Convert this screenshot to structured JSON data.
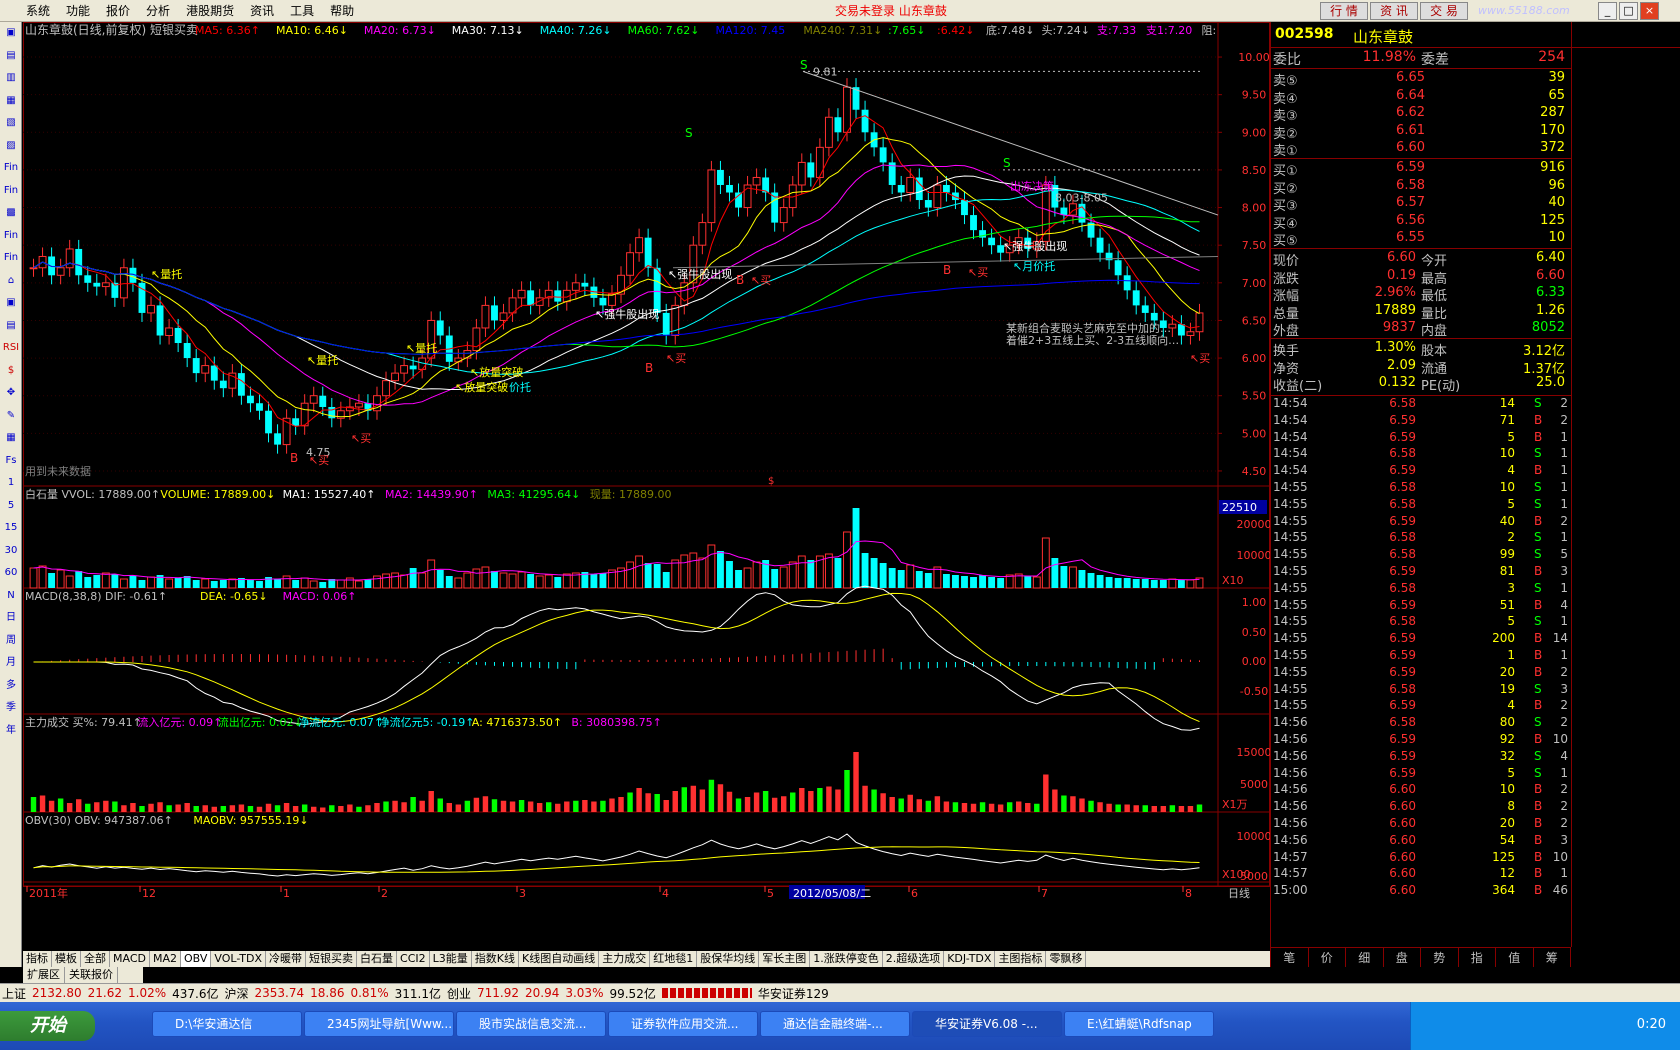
{
  "menu": {
    "items": [
      "系统",
      "功能",
      "报价",
      "分析",
      "港股期货",
      "资讯",
      "工具",
      "帮助"
    ],
    "center": "交易未登录  山东章鼓",
    "buttons": [
      "行 情",
      "资 讯",
      "交 易"
    ],
    "watermark": "www.55188.com"
  },
  "sidebar": {
    "items": [
      "▣",
      "▤",
      "▥",
      "▦",
      "▧",
      "▨",
      "Fin",
      "Fin",
      "▩",
      "Fin",
      "Fin",
      "⌂",
      "▣",
      "▤",
      "RSI",
      "$",
      "✥",
      "✎",
      "▦",
      "Fs",
      "1",
      "5",
      "15",
      "30",
      "60",
      "N",
      "日",
      "周",
      "月",
      "多",
      "季",
      "年"
    ]
  },
  "main": {
    "title": "山东章鼓(日线,前复权) 短银买卖",
    "ma_labels": [
      {
        "t": "MA5: 6.36↑",
        "c": "#ff0000"
      },
      {
        "t": "MA10: 6.46↓",
        "c": "#ffff00"
      },
      {
        "t": "MA20: 6.73↓",
        "c": "#ff00ff"
      },
      {
        "t": "MA30: 7.13↓",
        "c": "#ffffff"
      },
      {
        "t": "MA40: 7.26↓",
        "c": "#00ffff"
      },
      {
        "t": "MA60: 7.62↓",
        "c": "#00ff00"
      },
      {
        "t": "MA120: 7.45",
        "c": "#0000ff"
      },
      {
        "t": "MA240: 7.31↓",
        "c": "#808000"
      }
    ],
    "ind_labels": [
      {
        "t": ":7.65↓",
        "c": "#00ff00"
      },
      {
        "t": ":6.42↓",
        "c": "#ff0000"
      },
      {
        "t": "底:7.48↓",
        "c": "#c0c0c0"
      },
      {
        "t": "头:7.24↓",
        "c": "#c0c0c0"
      },
      {
        "t": "支:7.33",
        "c": "#ff00ff"
      },
      {
        "t": "支1:7.20",
        "c": "#ff00ff"
      },
      {
        "t": "阻:",
        "c": "#c0c0c0"
      }
    ],
    "price_axis": [
      "10.00",
      "9.50",
      "9.00",
      "8.50",
      "8.00",
      "7.50",
      "7.00",
      "6.50",
      "6.00",
      "5.50",
      "5.00",
      "4.50"
    ],
    "annotations": {
      "high": "9.81",
      "low": "4.75",
      "line": "8.03-8.05",
      "note1": "某新组合麦聪头艺麻克至中加的…",
      "note2": "着催2+3五线上买、2-3五线顺向…",
      "usefuture": "用到未来数据",
      "s": "S",
      "b": "B",
      "buy": "买",
      "liangtuo": "量托",
      "qiangniu": "强牛股出现",
      "fangliang": "放量突破",
      "jiatuo": "价托",
      "chudiao": "出冻决策",
      "yuejiatuo": "月价托"
    },
    "vol_labels": [
      {
        "t": "白石量 VVOL: 17889.00↑",
        "c": "#c0c0c0"
      },
      {
        "t": "VOLUME: 17889.00↓",
        "c": "#ffff00"
      },
      {
        "t": "MA1: 15527.40↑",
        "c": "#ffffff"
      },
      {
        "t": "MA2: 14439.90↑",
        "c": "#ff00ff"
      },
      {
        "t": "MA3: 41295.64↓",
        "c": "#00ff00"
      },
      {
        "t": "现量: 17889.00",
        "c": "#808000"
      }
    ],
    "vol_axis": [
      "20000",
      "10000"
    ],
    "vol_badge": "22510",
    "vol_unit": "X10",
    "macd_labels": [
      {
        "t": "MACD(8,38,8)  DIF: -0.61↑",
        "c": "#c0c0c0"
      },
      {
        "t": "DEA: -0.65↓",
        "c": "#ffff00"
      },
      {
        "t": "MACD: 0.06↑",
        "c": "#ff00ff"
      }
    ],
    "macd_axis": [
      "1.00",
      "0.50",
      "0.00",
      "-0.50"
    ],
    "zl_labels": [
      {
        "t": "主力成交  买%: 79.41↑",
        "c": "#c0c0c0"
      },
      {
        "t": "流入亿元: 0.09↑",
        "c": "#ff00ff"
      },
      {
        "t": "流出亿元: 0.02↓",
        "c": "#00ff00"
      },
      {
        "t": "净流亿元: 0.07↑",
        "c": "#00ffff"
      },
      {
        "t": "净流亿元5: -0.19↑",
        "c": "#00ffff"
      },
      {
        "t": "A: 4716373.50↑",
        "c": "#ffff00"
      },
      {
        "t": "B: 3080398.75↑",
        "c": "#ff00ff"
      }
    ],
    "zl_axis": [
      "15000",
      "5000"
    ],
    "zl_unit": "X1万",
    "obv_labels": [
      {
        "t": "OBV(30)  OBV: 947387.06↑",
        "c": "#c0c0c0"
      },
      {
        "t": "MAOBV: 957555.19↓",
        "c": "#ffff00"
      }
    ],
    "obv_axis": [
      "10000",
      "5000"
    ],
    "obv_unit": "X100",
    "date_axis": [
      "2011年",
      "12",
      "1",
      "2",
      "3",
      "4",
      "5",
      "2012/05/08/二",
      "6",
      "7",
      "8"
    ],
    "period": "日线",
    "dollar": "$"
  },
  "tabs": [
    "指标",
    "模板",
    "全部",
    "MACD",
    "MA2",
    "OBV",
    "VOL-TDX",
    "冷暖带",
    "短银买卖",
    "白石量",
    "CCI2",
    "L3能量",
    "指数K线",
    "K线图自动画线",
    "主力成交",
    "红地毯1",
    "股保华均线",
    "军长主图",
    "1.涨跌停变色",
    "2.超级选项",
    "KDJ-TDX",
    "主图指标",
    "零飘移"
  ],
  "tabs2": [
    "扩展区",
    "关联报价"
  ],
  "quote": {
    "code": "002598",
    "name": "山东章鼓",
    "weibi": {
      "label": "委比",
      "value": "11.98%",
      "label2": "委差",
      "value2": "254"
    },
    "sells": [
      {
        "l": "卖⑤",
        "p": "6.65",
        "v": "39"
      },
      {
        "l": "卖④",
        "p": "6.64",
        "v": "65"
      },
      {
        "l": "卖③",
        "p": "6.62",
        "v": "287"
      },
      {
        "l": "卖②",
        "p": "6.61",
        "v": "170"
      },
      {
        "l": "卖①",
        "p": "6.60",
        "v": "372"
      }
    ],
    "buys": [
      {
        "l": "买①",
        "p": "6.59",
        "v": "916"
      },
      {
        "l": "买②",
        "p": "6.58",
        "v": "96"
      },
      {
        "l": "买③",
        "p": "6.57",
        "v": "40"
      },
      {
        "l": "买④",
        "p": "6.56",
        "v": "125"
      },
      {
        "l": "买⑤",
        "p": "6.55",
        "v": "10"
      }
    ],
    "stats": [
      {
        "l": "现价",
        "v": "6.60",
        "c": "#ff3030",
        "l2": "今开",
        "v2": "6.40",
        "c2": "#ffff00"
      },
      {
        "l": "涨跌",
        "v": "0.19",
        "c": "#ff3030",
        "l2": "最高",
        "v2": "6.60",
        "c2": "#ff3030"
      },
      {
        "l": "涨幅",
        "v": "2.96%",
        "c": "#ff3030",
        "l2": "最低",
        "v2": "6.33",
        "c2": "#00ff00"
      },
      {
        "l": "总量",
        "v": "17889",
        "c": "#ffff00",
        "l2": "量比",
        "v2": "1.26",
        "c2": "#ffff00"
      },
      {
        "l": "外盘",
        "v": "9837",
        "c": "#ff3030",
        "l2": "内盘",
        "v2": "8052",
        "c2": "#00ff00"
      }
    ],
    "stats2": [
      {
        "l": "换手",
        "v": "1.30%",
        "l2": "股本",
        "v2": "3.12亿"
      },
      {
        "l": "净资",
        "v": "2.09",
        "l2": "流通",
        "v2": "1.37亿"
      },
      {
        "l": "收益(二)",
        "v": "0.132",
        "l2": "PE(动)",
        "v2": "25.0"
      }
    ],
    "ticks": [
      [
        "14:54",
        "6.58",
        "14",
        "S",
        "2"
      ],
      [
        "14:54",
        "6.59",
        "71",
        "B",
        "2"
      ],
      [
        "14:54",
        "6.59",
        "5",
        "B",
        "1"
      ],
      [
        "14:54",
        "6.58",
        "10",
        "S",
        "1"
      ],
      [
        "14:54",
        "6.59",
        "4",
        "B",
        "1"
      ],
      [
        "14:55",
        "6.58",
        "10",
        "S",
        "1"
      ],
      [
        "14:55",
        "6.58",
        "5",
        "S",
        "1"
      ],
      [
        "14:55",
        "6.59",
        "40",
        "B",
        "2"
      ],
      [
        "14:55",
        "6.58",
        "2",
        "S",
        "1"
      ],
      [
        "14:55",
        "6.58",
        "99",
        "S",
        "5"
      ],
      [
        "14:55",
        "6.59",
        "81",
        "B",
        "3"
      ],
      [
        "14:55",
        "6.58",
        "3",
        "S",
        "1"
      ],
      [
        "14:55",
        "6.59",
        "51",
        "B",
        "4"
      ],
      [
        "14:55",
        "6.58",
        "5",
        "S",
        "1"
      ],
      [
        "14:55",
        "6.59",
        "200",
        "B",
        "14"
      ],
      [
        "14:55",
        "6.59",
        "1",
        "B",
        "1"
      ],
      [
        "14:55",
        "6.59",
        "20",
        "B",
        "2"
      ],
      [
        "14:55",
        "6.58",
        "19",
        "S",
        "3"
      ],
      [
        "14:55",
        "6.59",
        "4",
        "B",
        "2"
      ],
      [
        "14:56",
        "6.58",
        "80",
        "S",
        "2"
      ],
      [
        "14:56",
        "6.59",
        "92",
        "B",
        "10"
      ],
      [
        "14:56",
        "6.59",
        "32",
        "S",
        "4"
      ],
      [
        "14:56",
        "6.59",
        "5",
        "S",
        "1"
      ],
      [
        "14:56",
        "6.60",
        "10",
        "B",
        "2"
      ],
      [
        "14:56",
        "6.60",
        "8",
        "B",
        "2"
      ],
      [
        "14:56",
        "6.60",
        "20",
        "B",
        "2"
      ],
      [
        "14:56",
        "6.60",
        "54",
        "B",
        "3"
      ],
      [
        "14:57",
        "6.60",
        "125",
        "B",
        "10"
      ],
      [
        "14:57",
        "6.60",
        "12",
        "B",
        "1"
      ],
      [
        "15:00",
        "6.60",
        "364",
        "B",
        "46"
      ]
    ],
    "bottom_tabs": [
      "笔",
      "价",
      "细",
      "盘",
      "势",
      "指",
      "值",
      "筹"
    ]
  },
  "status": {
    "sh": {
      "l": "上证",
      "v": "2132.80",
      "c": "21.62",
      "p": "1.02%",
      "a": "437.6亿"
    },
    "hs": {
      "l": "沪深",
      "v": "2353.74",
      "c": "18.86",
      "p": "0.81%",
      "a": "311.1亿"
    },
    "cy": {
      "l": "创业",
      "v": "711.92",
      "c": "20.94",
      "p": "3.03%",
      "a": "99.52亿"
    },
    "broker": "华安证券129"
  },
  "taskbar": {
    "start": "开始",
    "tasks": [
      "D:\\华安通达信",
      "2345网址导航[Www...",
      "股市实战信息交流...",
      "证券软件应用交流...",
      "通达信金融终端-...",
      "华安证券V6.08 -...",
      "E:\\红蜻蜓\\Rdfsnap"
    ],
    "time": "0:20"
  },
  "chart_data": {
    "type": "candlestick",
    "note": "Approximate daily OHLC for 山东章鼓, ~170 bars from 2011-11 to 2012-08",
    "high": 9.81,
    "low": 4.75,
    "closes": [
      7.2,
      7.35,
      7.1,
      7.2,
      7.45,
      7.1,
      7.0,
      6.95,
      7.0,
      6.8,
      7.2,
      7.0,
      6.6,
      6.7,
      6.3,
      6.4,
      6.2,
      6.0,
      5.8,
      5.9,
      5.7,
      5.6,
      5.8,
      5.5,
      5.4,
      5.3,
      5.0,
      4.85,
      5.2,
      5.1,
      5.4,
      5.5,
      5.35,
      5.2,
      5.3,
      5.35,
      5.4,
      5.3,
      5.5,
      5.7,
      5.8,
      5.9,
      5.85,
      6.0,
      6.5,
      6.3,
      5.95,
      6.0,
      6.1,
      6.4,
      6.7,
      6.5,
      6.6,
      6.8,
      6.9,
      6.7,
      6.8,
      6.9,
      6.75,
      6.9,
      7.0,
      6.95,
      6.8,
      6.7,
      6.85,
      7.1,
      7.4,
      7.6,
      7.2,
      6.6,
      6.3,
      6.7,
      7.0,
      7.5,
      7.8,
      8.5,
      8.3,
      8.2,
      8.0,
      8.3,
      8.4,
      8.2,
      7.8,
      8.0,
      8.3,
      8.6,
      8.4,
      8.8,
      9.2,
      9.0,
      9.6,
      9.3,
      9.0,
      8.8,
      8.6,
      8.3,
      8.2,
      8.4,
      8.1,
      8.0,
      8.3,
      8.2,
      8.1,
      7.9,
      7.7,
      7.6,
      7.5,
      7.4,
      7.5,
      7.6,
      7.45,
      7.55,
      8.3,
      8.0,
      7.9,
      8.05,
      7.8,
      7.6,
      7.4,
      7.3,
      7.1,
      6.9,
      6.7,
      6.6,
      6.5,
      6.4,
      6.45,
      6.3,
      6.35,
      6.6
    ],
    "volume": [
      2000,
      2200,
      1500,
      1800,
      1200,
      1700,
      1100,
      1300,
      1500,
      1400,
      900,
      1200,
      800,
      1100,
      1300,
      900,
      1000,
      1200,
      800,
      900,
      700,
      800,
      900,
      1000,
      800,
      700,
      1100,
      900,
      1200,
      800,
      1000,
      700,
      600,
      900,
      800,
      1000,
      700,
      900,
      1200,
      1400,
      1500,
      1300,
      2000,
      1500,
      2800,
      1800,
      1200,
      1000,
      1500,
      1900,
      2100,
      1700,
      1500,
      1400,
      1600,
      1400,
      1200,
      1300,
      1100,
      1400,
      1500,
      1600,
      1400,
      1500,
      1800,
      2000,
      2600,
      3200,
      2500,
      2400,
      1600,
      2800,
      3300,
      3500,
      3000,
      4300,
      3700,
      2700,
      1800,
      2000,
      2600,
      2800,
      1900,
      2100,
      2600,
      3200,
      2800,
      3200,
      3400,
      3000,
      5600,
      8000,
      3500,
      3000,
      2500,
      2000,
      1800,
      2300,
      1700,
      1500,
      2100,
      1400,
      1300,
      1200,
      1100,
      1300,
      1100,
      1000,
      1300,
      1400,
      1200,
      1100,
      5000,
      3000,
      2200,
      2100,
      1800,
      1500,
      1300,
      1100,
      1000,
      1000,
      900,
      900,
      800,
      800,
      900,
      800,
      800,
      1000
    ]
  }
}
